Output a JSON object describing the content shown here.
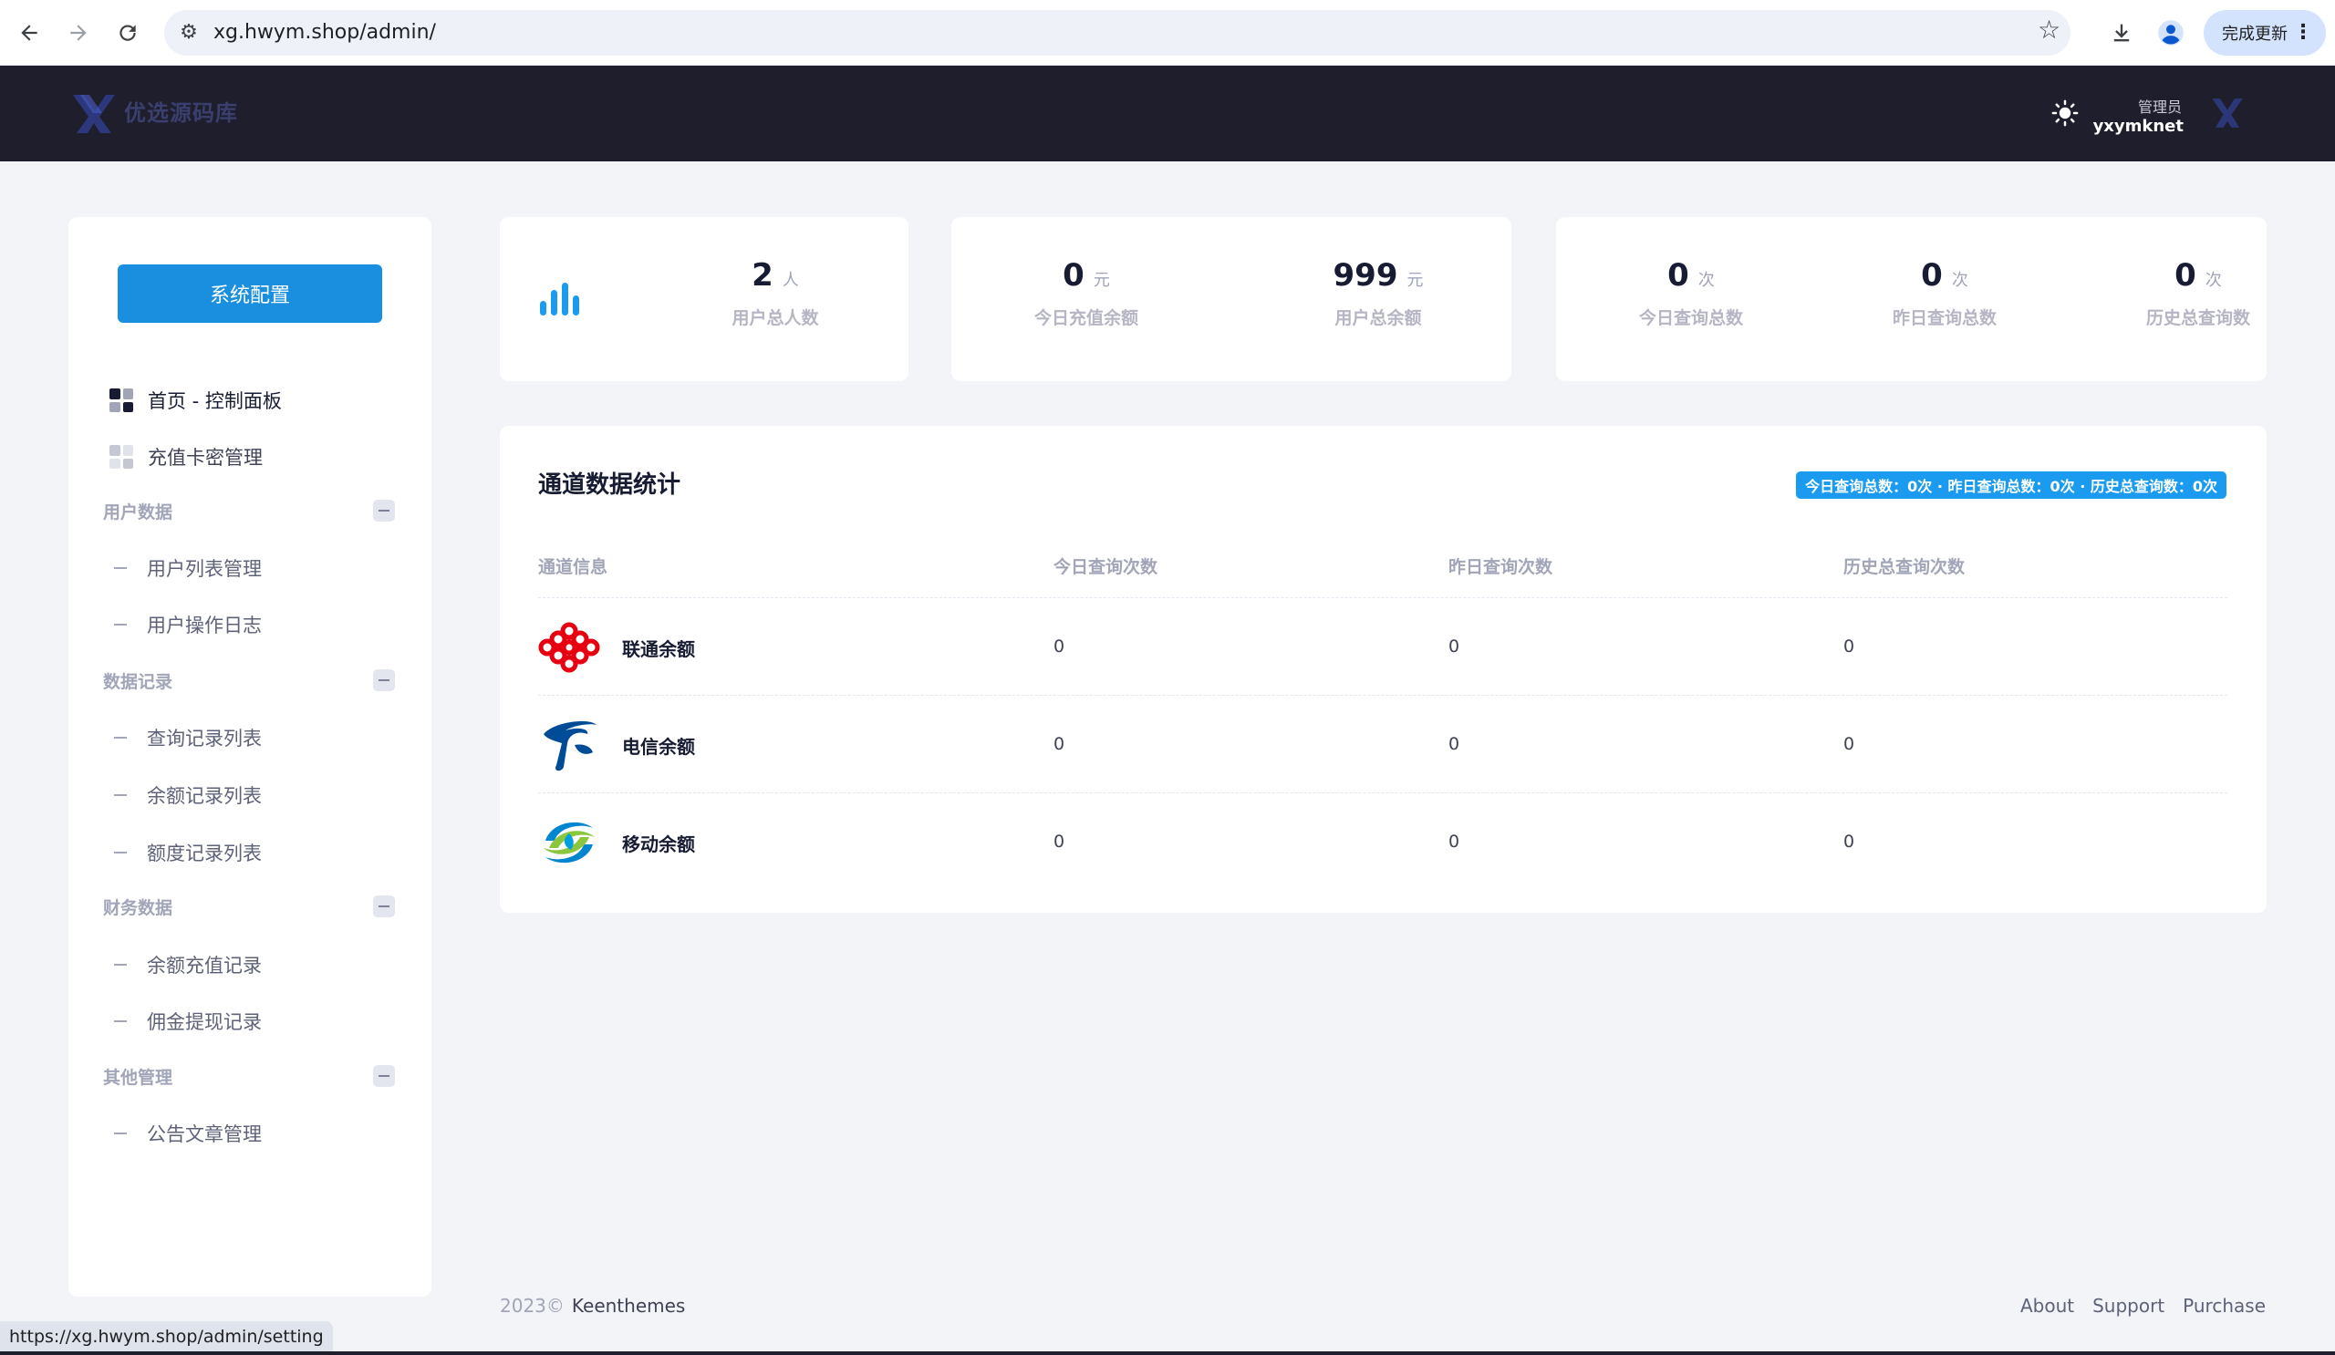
{
  "browser": {
    "url": "xg.hwym.shop/admin/",
    "update_label": "完成更新",
    "status_url": "https://xg.hwym.shop/admin/setting"
  },
  "header": {
    "logo_text": "优选源码库",
    "user_role": "管理员",
    "user_name": "yxymknet"
  },
  "sidebar": {
    "config_button": "系统配置",
    "items": {
      "dashboard": "首页 - 控制面板",
      "cards": "充值卡密管理"
    },
    "sections": [
      {
        "title": "用户数据",
        "items": [
          "用户列表管理",
          "用户操作日志"
        ]
      },
      {
        "title": "数据记录",
        "items": [
          "查询记录列表",
          "余额记录列表",
          "额度记录列表"
        ]
      },
      {
        "title": "财务数据",
        "items": [
          "余额充值记录",
          "佣金提现记录"
        ]
      },
      {
        "title": "其他管理",
        "items": [
          "公告文章管理"
        ]
      }
    ]
  },
  "stats": {
    "users": {
      "value": "2",
      "unit": "人",
      "label": "用户总人数"
    },
    "today_recharge": {
      "value": "0",
      "unit": "元",
      "label": "今日充值余额"
    },
    "user_balance": {
      "value": "999",
      "unit": "元",
      "label": "用户总余额"
    },
    "today_queries": {
      "value": "0",
      "unit": "次",
      "label": "今日查询总数"
    },
    "yesterday_queries": {
      "value": "0",
      "unit": "次",
      "label": "昨日查询总数"
    },
    "history_queries": {
      "value": "0",
      "unit": "次",
      "label": "历史总查询数"
    }
  },
  "channels": {
    "title": "通道数据统计",
    "summary": "今日查询总数：0次 · 昨日查询总数：0次 · 历史总查询数：0次",
    "headers": [
      "通道信息",
      "今日查询次数",
      "昨日查询次数",
      "历史总查询次数"
    ],
    "rows": [
      {
        "name": "联通余额",
        "today": "0",
        "yesterday": "0",
        "history": "0"
      },
      {
        "name": "电信余额",
        "today": "0",
        "yesterday": "0",
        "history": "0"
      },
      {
        "name": "移动余额",
        "today": "0",
        "yesterday": "0",
        "history": "0"
      }
    ]
  },
  "footer": {
    "year": "2023©",
    "brand": "Keenthemes",
    "links": [
      "About",
      "Support",
      "Purchase"
    ]
  },
  "colors": {
    "primary": "#1a8fe0",
    "header_bg": "#1e1e2d",
    "badge": "#1a9bf0",
    "chart_bars": "#1a9bf0"
  }
}
